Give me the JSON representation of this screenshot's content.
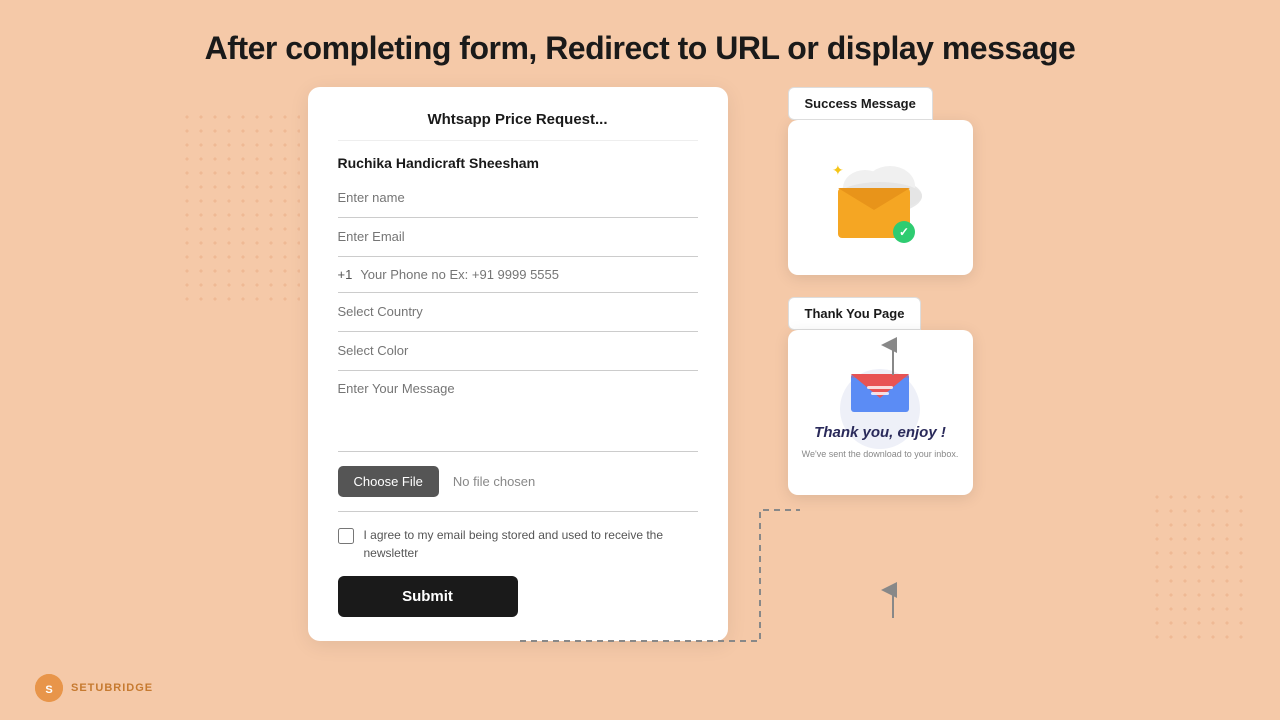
{
  "page": {
    "title": "After completing form, Redirect to URL or display message"
  },
  "form": {
    "title": "Whtsapp Price Request...",
    "store_name": "Ruchika Handicraft Sheesham",
    "fields": {
      "name_placeholder": "Enter name",
      "email_placeholder": "Enter Email",
      "phone_prefix": "+1",
      "phone_placeholder": "Your Phone no Ex: +91 9999 5555",
      "country_placeholder": "Select Country",
      "color_placeholder": "Select Color",
      "message_placeholder": "Enter Your Message",
      "file_button": "Choose File",
      "no_file": "No file chosen"
    },
    "checkbox_label": "I agree to my email being stored and used to receive the newsletter",
    "submit_label": "Submit"
  },
  "success_block": {
    "badge": "Success Message"
  },
  "thankyou_block": {
    "badge": "Thank You Page",
    "text": "Thank you, enjoy !",
    "subtext": "We've sent the download to your inbox."
  },
  "logo": {
    "text": "SETUBRIDGE"
  }
}
